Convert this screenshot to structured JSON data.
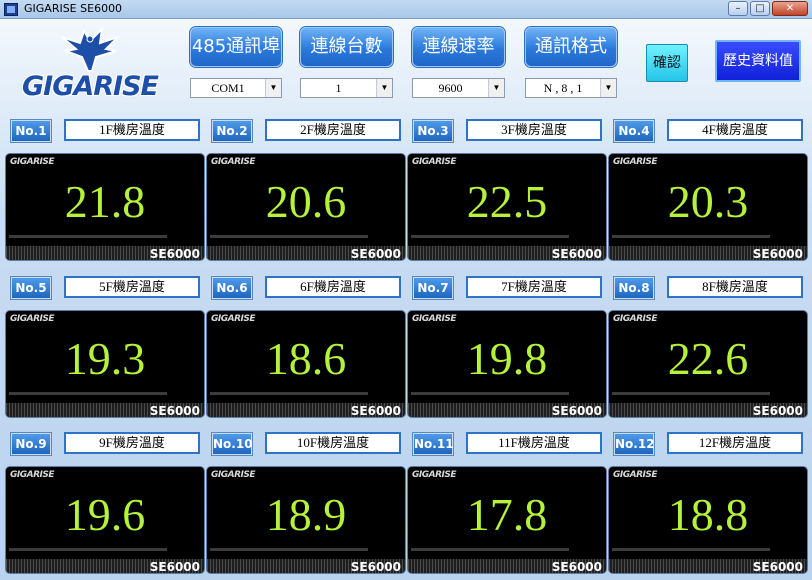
{
  "window": {
    "title": "GIGARISE     SE6000",
    "min": "–",
    "max": "□",
    "close": "✕"
  },
  "logo": {
    "brand": "GIGARISE",
    "icon": "eagle-logo-icon"
  },
  "controls": [
    {
      "label": "485通訊埠",
      "value": "COM1"
    },
    {
      "label": "連線台數",
      "value": "1"
    },
    {
      "label": "連線速率",
      "value": "9600"
    },
    {
      "label": "通訊格式",
      "value": "N , 8 , 1"
    }
  ],
  "confirm_label": "確認",
  "history_label": "歷史資料值",
  "units": [
    {
      "no": "No.1",
      "name": "1F機房溫度",
      "value": "21.8",
      "brand": "GIGARISE",
      "model": "SE6000"
    },
    {
      "no": "No.2",
      "name": "2F機房溫度",
      "value": "20.6",
      "brand": "GIGARISE",
      "model": "SE6000"
    },
    {
      "no": "No.3",
      "name": "3F機房溫度",
      "value": "22.5",
      "brand": "GIGARISE",
      "model": "SE6000"
    },
    {
      "no": "No.4",
      "name": "4F機房溫度",
      "value": "20.3",
      "brand": "GIGARISE",
      "model": "SE6000"
    },
    {
      "no": "No.5",
      "name": "5F機房溫度",
      "value": "19.3",
      "brand": "GIGARISE",
      "model": "SE6000"
    },
    {
      "no": "No.6",
      "name": "6F機房溫度",
      "value": "18.6",
      "brand": "GIGARISE",
      "model": "SE6000"
    },
    {
      "no": "No.7",
      "name": "7F機房溫度",
      "value": "19.8",
      "brand": "GIGARISE",
      "model": "SE6000"
    },
    {
      "no": "No.8",
      "name": "8F機房溫度",
      "value": "22.6",
      "brand": "GIGARISE",
      "model": "SE6000"
    },
    {
      "no": "No.9",
      "name": "9F機房溫度",
      "value": "19.6",
      "brand": "GIGARISE",
      "model": "SE6000"
    },
    {
      "no": "No.10",
      "name": "10F機房溫度",
      "value": "18.9",
      "brand": "GIGARISE",
      "model": "SE6000"
    },
    {
      "no": "No.11",
      "name": "11F機房溫度",
      "value": "17.8",
      "brand": "GIGARISE",
      "model": "SE6000"
    },
    {
      "no": "No.12",
      "name": "12F機房溫度",
      "value": "18.8",
      "brand": "GIGARISE",
      "model": "SE6000"
    }
  ],
  "colors": {
    "display_text": "#b5f23a",
    "button_blue": "#2a79dc",
    "confirm_cyan": "#25c4e8",
    "history_blue": "#1020d8"
  }
}
